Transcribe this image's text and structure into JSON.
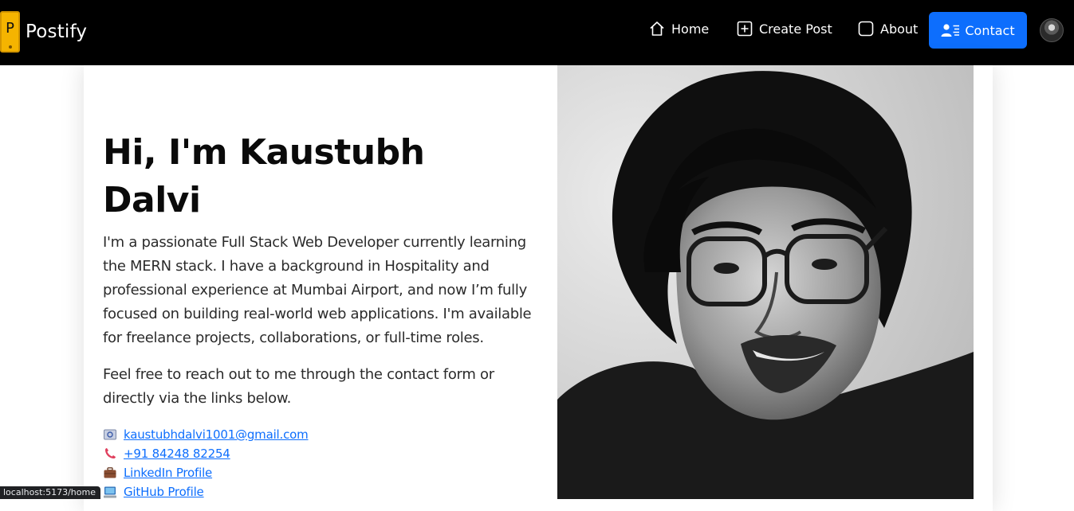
{
  "brand": {
    "logo_letter": "P",
    "name": "Postify"
  },
  "nav": {
    "items": [
      {
        "label": "Home",
        "icon": "home-icon"
      },
      {
        "label": "Create Post",
        "icon": "plus-square-icon"
      },
      {
        "label": "About",
        "icon": "square-icon"
      },
      {
        "label": "Contact",
        "icon": "person-lines-icon"
      }
    ],
    "contact_color": "#0d6efd"
  },
  "intro": {
    "title": "Hi, I'm Kaustubh Dalvi",
    "paragraph1": "I'm a passionate Full Stack Web Developer currently learning the MERN stack. I have a background in Hospitality and professional experience at Mumbai Airport, and now I’m fully focused on building real-world web applications. I'm available for freelance projects, collaborations, or full-time roles.",
    "paragraph2": "Feel free to reach out to me through the contact form or directly via the links below."
  },
  "links": [
    {
      "icon": "email-icon",
      "text": "kaustubhdalvi1001@gmail.com"
    },
    {
      "icon": "phone-icon",
      "text": "+91 84248 82254"
    },
    {
      "icon": "briefcase-icon",
      "text": "LinkedIn Profile"
    },
    {
      "icon": "computer-icon",
      "text": "GitHub Profile"
    }
  ],
  "status_url": "localhost:5173/home"
}
